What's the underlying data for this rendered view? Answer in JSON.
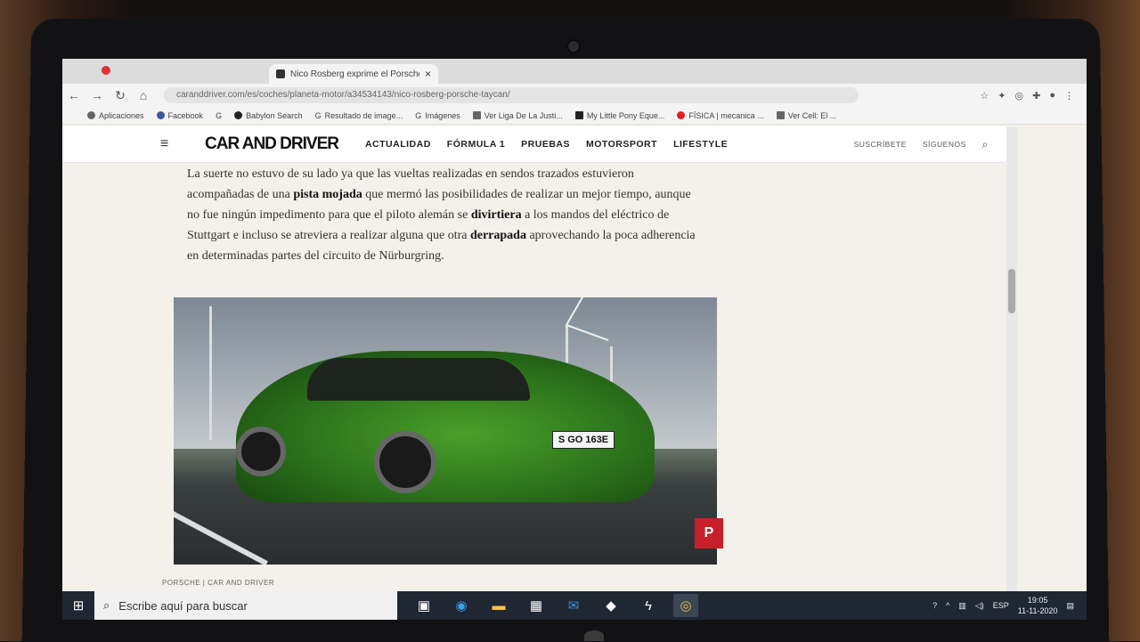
{
  "browser": {
    "tab_title": "Nico Rosberg exprime el Porsche ...",
    "tab_close": "×",
    "url": "caranddriver.com/es/coches/planeta-motor/a34534143/nico-rosberg-porsche-taycan/",
    "bookmarks": [
      "Aplicaciones",
      "Facebook",
      "G",
      "Babylon Search",
      "Resultado de image...",
      "Imágenes",
      "Ver Liga De La Justi...",
      "My Little Pony Eque...",
      "FÍSICA | mecanica ...",
      "Ver Cell: El ..."
    ]
  },
  "site": {
    "brand": "CAR AND DRIVER",
    "nav": [
      "ACTUALIDAD",
      "FÓRMULA 1",
      "PRUEBAS",
      "MOTORSPORT",
      "LIFESTYLE"
    ],
    "right_links": [
      "SUSCRÍBETE",
      "SÍGUENOS"
    ]
  },
  "article": {
    "p1": "La suerte no estuvo de su lado ya que las vueltas realizadas en sendos trazados estuvieron acompañadas de una ",
    "p1_bold": "pista mojada",
    "p2": " que mermó las posibilidades de realizar un mejor tiempo, aunque no fue ningún impedimento para que el piloto alemán se ",
    "p2_bold": "divirtiera",
    "p3": " a los mandos del eléctrico de Stuttgart e incluso se atreviera a realizar alguna que otra ",
    "p3_bold": "derrapada",
    "p4": " aprovechando la poca adherencia en determinadas partes del circuito de Nürburgring.",
    "plate": "S GO 163E",
    "pin": "P",
    "caption": "PORSCHE  |  CAR AND DRIVER"
  },
  "taskbar": {
    "search_placeholder": "Escribe aquí para buscar",
    "lang": "ESP",
    "time": "19:05",
    "date": "11-11-2020"
  },
  "colors": {
    "pin": "#c8202a",
    "taskbar": "#1f2733"
  }
}
